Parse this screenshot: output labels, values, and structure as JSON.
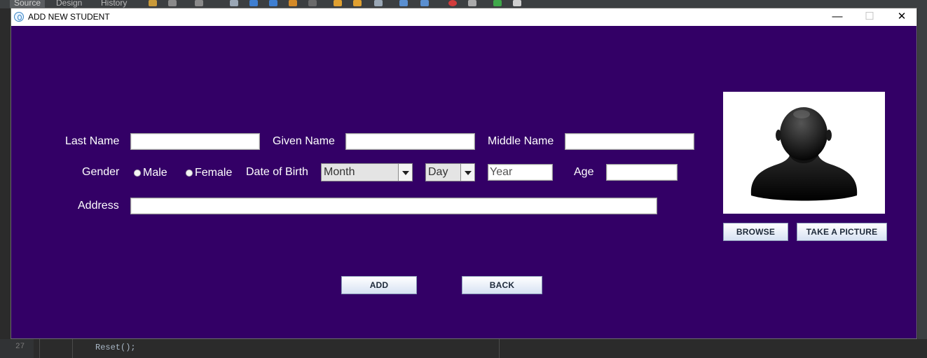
{
  "ide": {
    "tabs": [
      "Source",
      "Design",
      "History"
    ],
    "line_number": "27",
    "code_line": "Reset();"
  },
  "window": {
    "title": "ADD NEW STUDENT",
    "minimize": "—",
    "maximize": "☐",
    "close": "✕"
  },
  "form": {
    "last_name_label": "Last Name",
    "last_name_value": "",
    "given_name_label": "Given Name",
    "given_name_value": "",
    "middle_name_label": "Middle Name",
    "middle_name_value": "",
    "gender_label": "Gender",
    "gender_options": [
      "Male",
      "Female"
    ],
    "dob_label": "Date of Birth",
    "month_value": "Month",
    "day_value": "Day",
    "year_value": "Year",
    "age_label": "Age",
    "age_value": "",
    "address_label": "Address",
    "address_value": ""
  },
  "photo": {
    "icon": "person-silhouette-icon",
    "browse_label": "BROWSE",
    "take_picture_label": "TAKE A PICTURE"
  },
  "actions": {
    "add_label": "ADD",
    "back_label": "BACK"
  },
  "colors": {
    "background": "#330066",
    "title_bar": "#ffffff",
    "label_text": "#ffffff"
  }
}
